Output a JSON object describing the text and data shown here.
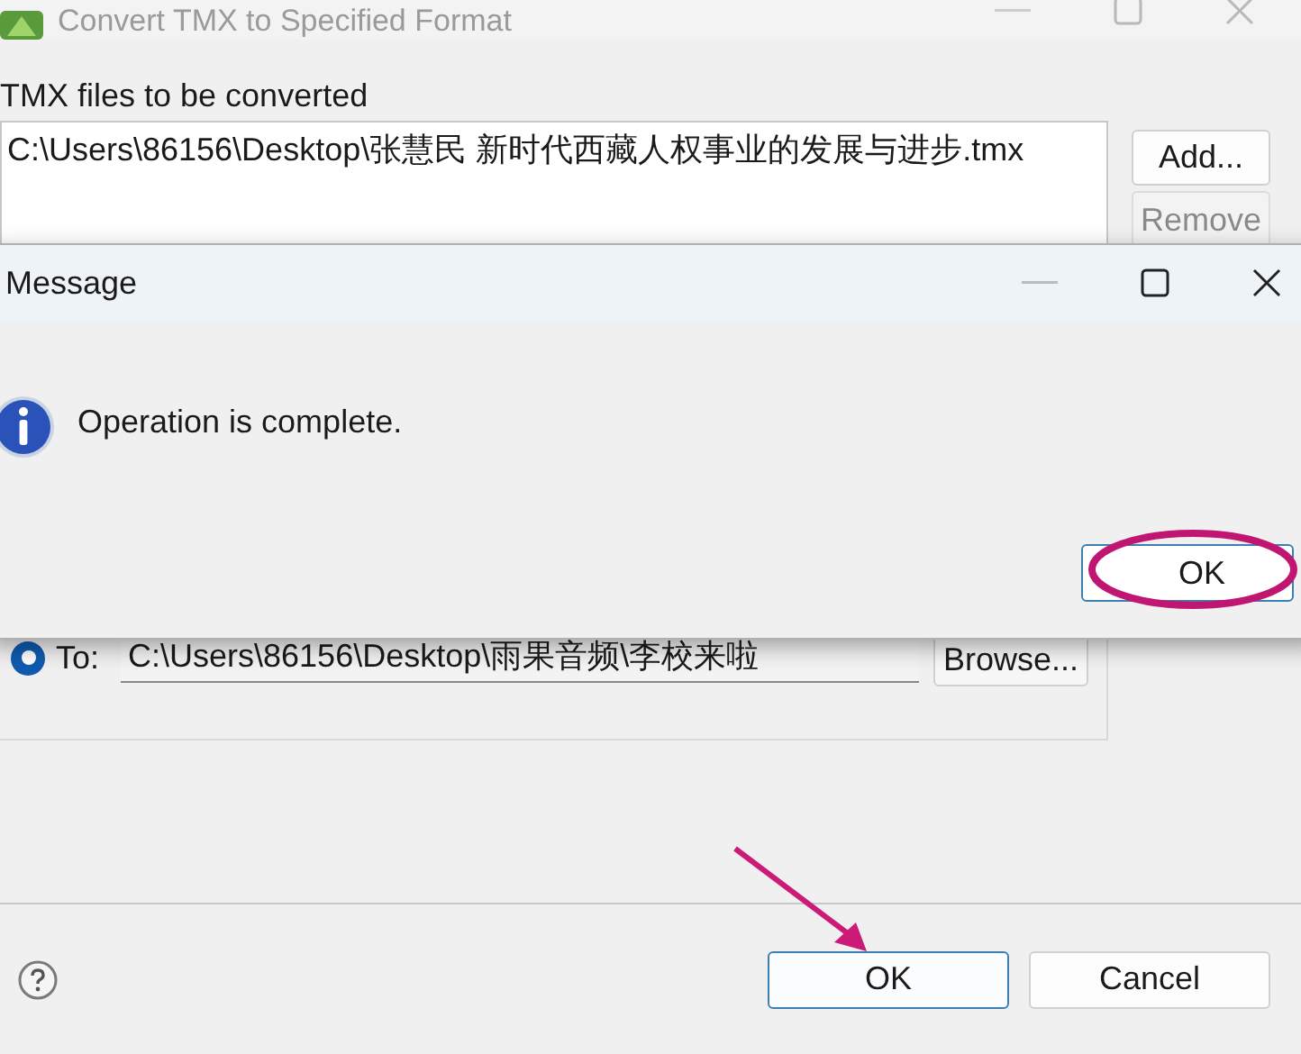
{
  "main_window": {
    "title": "Convert TMX to Specified Format",
    "files_label": "TMX files to be converted",
    "files": [
      "C:\\Users\\86156\\Desktop\\张慧民 新时代西藏人权事业的发展与进步.tmx"
    ],
    "add_button": {
      "label": "Add...",
      "disabled": false
    },
    "remove_button": {
      "label": "Remove",
      "disabled": true
    },
    "output": {
      "label": "To:",
      "selected": true,
      "path": "C:\\Users\\86156\\Desktop\\雨果音频\\李校来啦",
      "browse_button": "Browse..."
    },
    "ok_button": "OK",
    "cancel_button": "Cancel"
  },
  "message_dialog": {
    "title": "Message",
    "text": "Operation is complete.",
    "ok_button": "OK"
  }
}
